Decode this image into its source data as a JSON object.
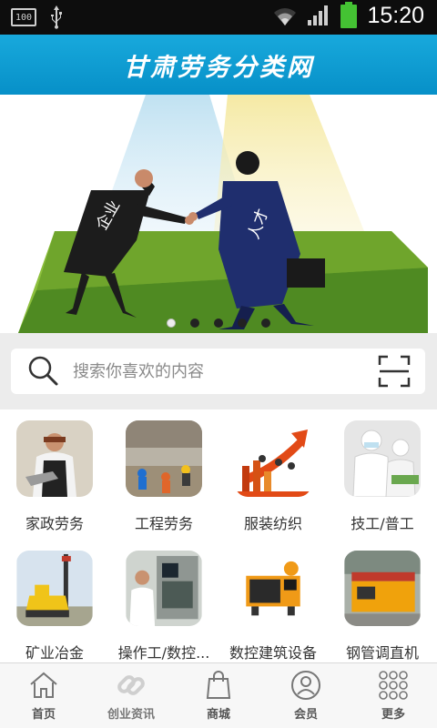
{
  "status_bar": {
    "battery_level_text": "100",
    "time": "15:20"
  },
  "header": {
    "title": "甘肃劳务分类网"
  },
  "banner": {
    "left_figure_label": "企业",
    "right_figure_label": "人才",
    "slide_count": 5,
    "active_slide": 1
  },
  "search": {
    "placeholder": "搜索你喜欢的内容"
  },
  "categories": [
    {
      "label": "家政劳务"
    },
    {
      "label": "工程劳务"
    },
    {
      "label": "服装纺织"
    },
    {
      "label": "技工/普工"
    },
    {
      "label": "矿业冶金"
    },
    {
      "label": "操作工/数控..."
    },
    {
      "label": "数控建筑设备"
    },
    {
      "label": "钢管调直机"
    }
  ],
  "bottom_nav": [
    {
      "label": "首页",
      "icon": "home-icon"
    },
    {
      "label": "创业资讯",
      "icon": "link-icon"
    },
    {
      "label": "商城",
      "icon": "shopping-bag-icon"
    },
    {
      "label": "会员",
      "icon": "user-icon"
    },
    {
      "label": "更多",
      "icon": "grid-dots-icon"
    }
  ],
  "colors": {
    "header_blue": "#0b9bd2",
    "battery_green": "#44c233"
  }
}
